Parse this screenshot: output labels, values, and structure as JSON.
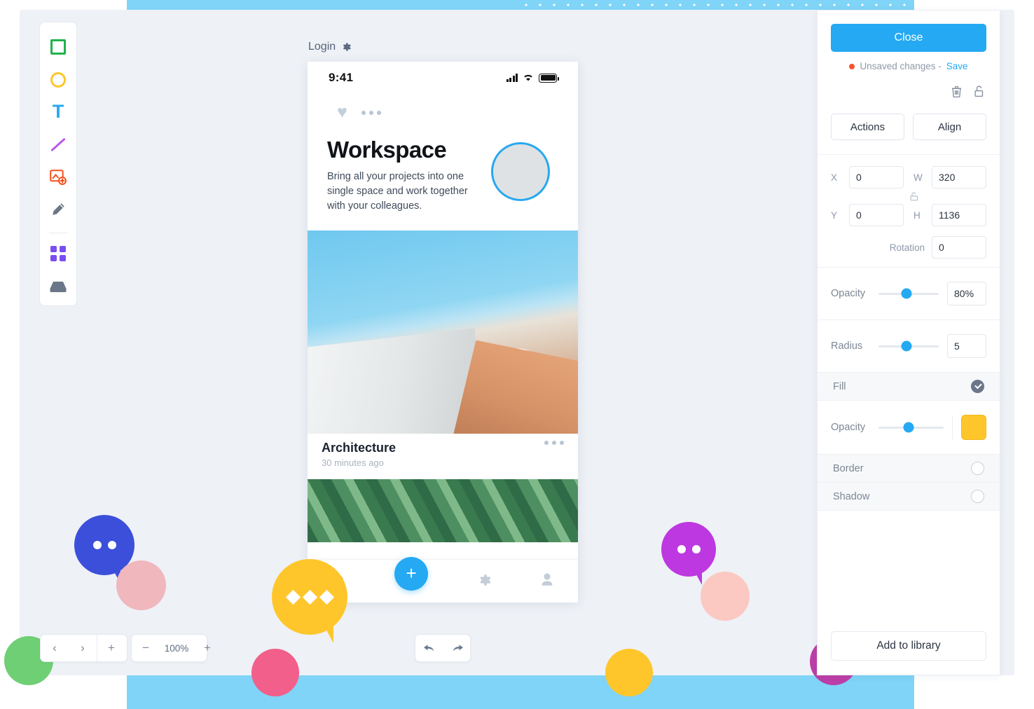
{
  "decor": {
    "band_color": "#7fd4f7",
    "canvas_bg": "#eef1f6"
  },
  "toolbar": {
    "items": [
      {
        "name": "rectangle-tool",
        "icon": "square-icon",
        "color": "#22b24c"
      },
      {
        "name": "ellipse-tool",
        "icon": "circle-icon",
        "color": "#ffc62b"
      },
      {
        "name": "text-tool",
        "icon": "text-icon",
        "label": "T",
        "color": "#29a9f2"
      },
      {
        "name": "line-tool",
        "icon": "line-icon",
        "color": "#b657e8"
      },
      {
        "name": "image-tool",
        "icon": "image-add-icon",
        "color": "#f4511e"
      },
      {
        "name": "pencil-tool",
        "icon": "pencil-icon",
        "color": "#5d6b80"
      },
      {
        "name": "components-tool",
        "icon": "grid-icon",
        "color": "#7a4df0"
      },
      {
        "name": "assets-tool",
        "icon": "tray-icon",
        "color": "#6b7688"
      }
    ]
  },
  "artboard": {
    "label": "Login",
    "settings_icon": "gear-icon",
    "status_bar": {
      "time": "9:41",
      "signal_icon": "signal-icon",
      "wifi_icon": "wifi-icon",
      "battery_icon": "battery-icon"
    },
    "actions": {
      "like_icon": "heart-icon",
      "more_icon": "more-dots-icon"
    },
    "hero": {
      "title": "Workspace",
      "subtitle": "Bring all your projects into one single space and work together with your colleagues.",
      "avatar_name": "hero-avatar"
    },
    "cards": [
      {
        "title": "Architecture",
        "time": "30 minutes ago",
        "more_icon": "more-dots-icon",
        "image": "architecture-photo"
      },
      {
        "image": "leaves-photo"
      }
    ],
    "tabbar": {
      "items": [
        {
          "name": "tab-notifications",
          "icon": "bell-icon"
        },
        {
          "name": "tab-add",
          "icon": "plus-icon",
          "label": "+"
        },
        {
          "name": "tab-settings",
          "icon": "gear-icon"
        },
        {
          "name": "tab-profile",
          "icon": "person-icon"
        }
      ]
    }
  },
  "collaborators": [
    {
      "name": "collab-blue",
      "bubble_color": "#3b4fdb",
      "dots": 2,
      "dot_shape": "circle",
      "avatar_bg": "#f0b7bd"
    },
    {
      "name": "collab-yellow",
      "bubble_color": "#ffc62b",
      "dots": 3,
      "dot_shape": "diamond",
      "avatar_bg": "#f25f8a"
    },
    {
      "name": "collab-purple",
      "bubble_color": "#bd38e0",
      "dots": 2,
      "dot_shape": "circle",
      "avatar_bg": "#fbc8c2"
    }
  ],
  "avatars": [
    {
      "name": "avatar-user-green",
      "bg": "#6fcf74"
    },
    {
      "name": "avatar-user-pink-bubble",
      "bg": "#f0b7bd"
    },
    {
      "name": "avatar-user-rose",
      "bg": "#f25f8a"
    },
    {
      "name": "avatar-user-yellow",
      "bg": "#ffc62b"
    },
    {
      "name": "avatar-user-peach",
      "bg": "#fbc8c2"
    },
    {
      "name": "avatar-user-magenta",
      "bg": "#bd3fa8"
    }
  ],
  "page_controls": {
    "prev_icon": "chevron-left-icon",
    "next_icon": "chevron-right-icon",
    "add_icon": "plus-icon",
    "prev_label": "‹",
    "next_label": "›",
    "add_label": "+"
  },
  "zoom_controls": {
    "minus_label": "−",
    "plus_label": "+",
    "level": "100%"
  },
  "history_controls": {
    "undo_icon": "undo-arrow-icon",
    "redo_icon": "redo-arrow-icon",
    "undo_label": "↩",
    "redo_label": "↪"
  },
  "panel": {
    "close_label": "Close",
    "status_text": "Unsaved changes - ",
    "save_label": "Save",
    "status_dot_color": "#f7522f",
    "object_icons": [
      {
        "name": "delete-icon",
        "icon": "trash-icon"
      },
      {
        "name": "lock-icon",
        "icon": "unlock-icon"
      }
    ],
    "actions_label": "Actions",
    "align_label": "Align",
    "geometry": {
      "x_label": "X",
      "x_value": "0",
      "y_label": "Y",
      "y_value": "0",
      "w_label": "W",
      "w_value": "320",
      "h_label": "H",
      "h_value": "1136",
      "lock_icon": "lock-ratio-icon",
      "rotation_label": "Rotation",
      "rotation_value": "0"
    },
    "opacity": {
      "label": "Opacity",
      "value": "80%",
      "knob_percent": 46
    },
    "radius": {
      "label": "Radius",
      "value": "5",
      "knob_percent": 46
    },
    "fill": {
      "label": "Fill",
      "enabled": true,
      "opacity_label": "Opacity",
      "opacity_knob_percent": 46,
      "color": "#ffc62b"
    },
    "border": {
      "label": "Border",
      "enabled": false
    },
    "shadow": {
      "label": "Shadow",
      "enabled": false
    },
    "add_library_label": "Add to library"
  }
}
